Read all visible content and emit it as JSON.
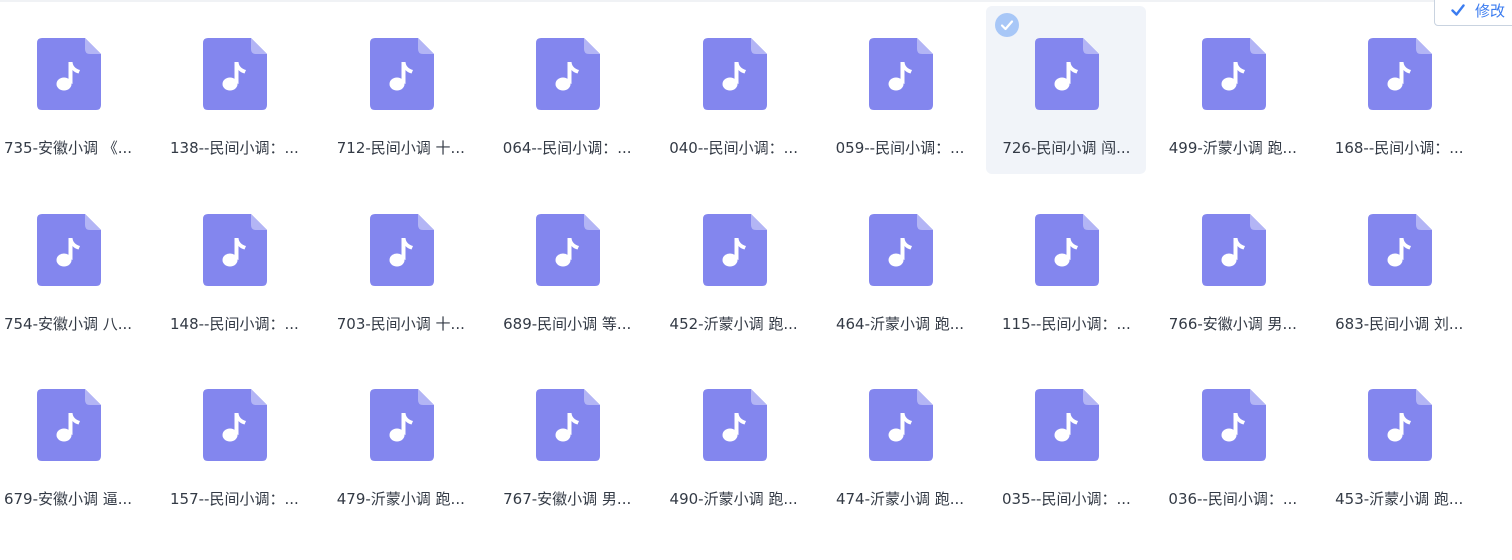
{
  "toolbar": {
    "edit_label": "修改",
    "edit_icon": "check-icon"
  },
  "colors": {
    "icon_fill": "#8386ee",
    "icon_fold": "#b3b5f5",
    "selected_bg": "#f1f4f9",
    "badge": "#a8c7f7",
    "accent": "#3b7cf0",
    "text": "#333a45"
  },
  "files": {
    "items": [
      {
        "name": "735-安徽小调 《...",
        "selected": false
      },
      {
        "name": "138--民间小调：...",
        "selected": false
      },
      {
        "name": "712-民间小调 十...",
        "selected": false
      },
      {
        "name": "064--民间小调：...",
        "selected": false
      },
      {
        "name": "040--民间小调：...",
        "selected": false
      },
      {
        "name": "059--民间小调：...",
        "selected": false
      },
      {
        "name": "726-民间小调 闯...",
        "selected": true
      },
      {
        "name": "499-沂蒙小调 跑...",
        "selected": false
      },
      {
        "name": "168--民间小调：...",
        "selected": false
      },
      {
        "name": "754-安徽小调 八...",
        "selected": false
      },
      {
        "name": "148--民间小调：...",
        "selected": false
      },
      {
        "name": "703-民间小调 十...",
        "selected": false
      },
      {
        "name": "689-民间小调 等...",
        "selected": false
      },
      {
        "name": "452-沂蒙小调 跑...",
        "selected": false
      },
      {
        "name": "464-沂蒙小调 跑...",
        "selected": false
      },
      {
        "name": "115--民间小调：...",
        "selected": false
      },
      {
        "name": "766-安徽小调 男...",
        "selected": false
      },
      {
        "name": "683-民间小调 刘...",
        "selected": false
      },
      {
        "name": "679-安徽小调 逼...",
        "selected": false
      },
      {
        "name": "157--民间小调：...",
        "selected": false
      },
      {
        "name": "479-沂蒙小调 跑...",
        "selected": false
      },
      {
        "name": "767-安徽小调 男...",
        "selected": false
      },
      {
        "name": "490-沂蒙小调 跑...",
        "selected": false
      },
      {
        "name": "474-沂蒙小调 跑...",
        "selected": false
      },
      {
        "name": "035--民间小调：...",
        "selected": false
      },
      {
        "name": "036--民间小调：...",
        "selected": false
      },
      {
        "name": "453-沂蒙小调 跑...",
        "selected": false
      }
    ]
  }
}
